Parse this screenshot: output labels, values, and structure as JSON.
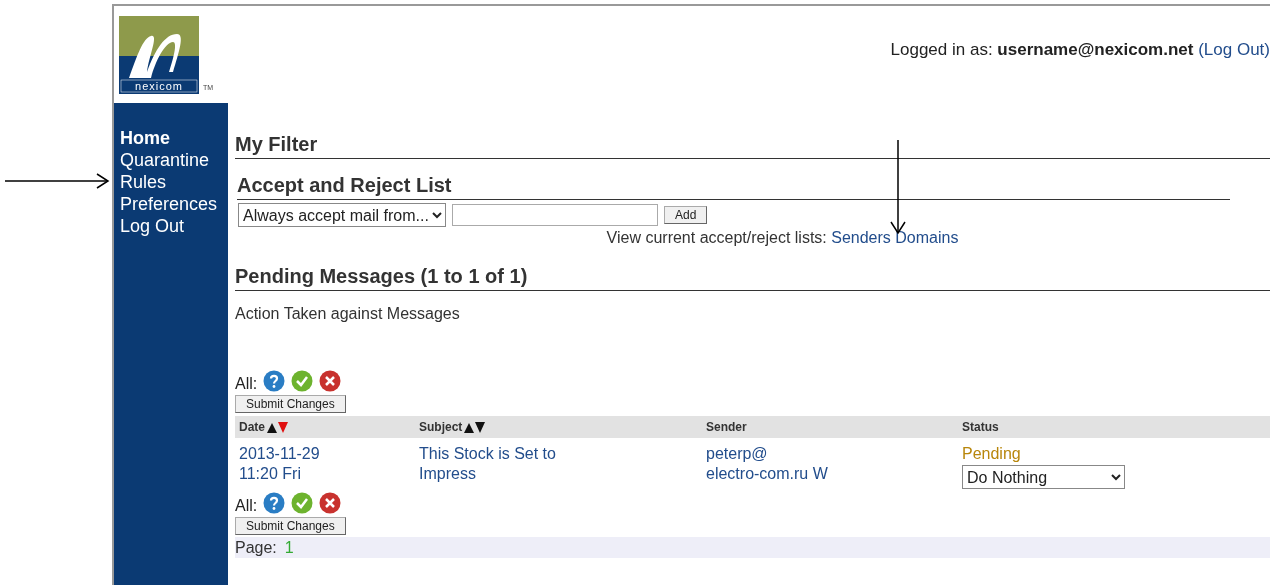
{
  "logo": {
    "wordmark": "nexicom",
    "trademark": "TM"
  },
  "login": {
    "text": "Logged in as: **username@nexicom.net**",
    "link": "(Log Out)"
  },
  "sidebar": {
    "items": [
      {
        "label": "Home",
        "selected": true
      },
      {
        "label": "Quarantine",
        "selected": false
      },
      {
        "label": "Rules",
        "selected": false
      },
      {
        "label": "Preferences",
        "selected": false
      },
      {
        "label": "Log Out",
        "selected": false
      }
    ]
  },
  "page_title": "My Filter",
  "accept_reject": {
    "heading": "Accept and Reject List",
    "list_select": "Always accept mail from...",
    "add_button": "Add",
    "view_text": "View current accept/reject lists:",
    "links": [
      "Senders",
      "Domains"
    ]
  },
  "pending": {
    "heading": "Pending Messages (1 to 1 of 1)",
    "subtitle": "Action Taken against Messages",
    "action_bars": [
      {
        "label": "All:",
        "button": "Submit Changes"
      },
      {
        "label": "All:",
        "button": "Submit Changes"
      }
    ],
    "columns": [
      {
        "label": "Date",
        "sorted": true
      },
      {
        "label": "Subject",
        "sorted": false
      },
      {
        "label": "Sender"
      },
      {
        "label": "Status"
      }
    ],
    "rows": [
      {
        "date": [
          "2013-11-29",
          "11:20 Fri"
        ],
        "subject": [
          "This Stock is Set to",
          "Impress"
        ],
        "sender": [
          "peterp@",
          "electro-com.ru W"
        ],
        "status": "Pending",
        "action": "Do Nothing"
      }
    ],
    "page_label": "Page:",
    "pages": [
      {
        "label": "1",
        "selected": true
      }
    ]
  }
}
